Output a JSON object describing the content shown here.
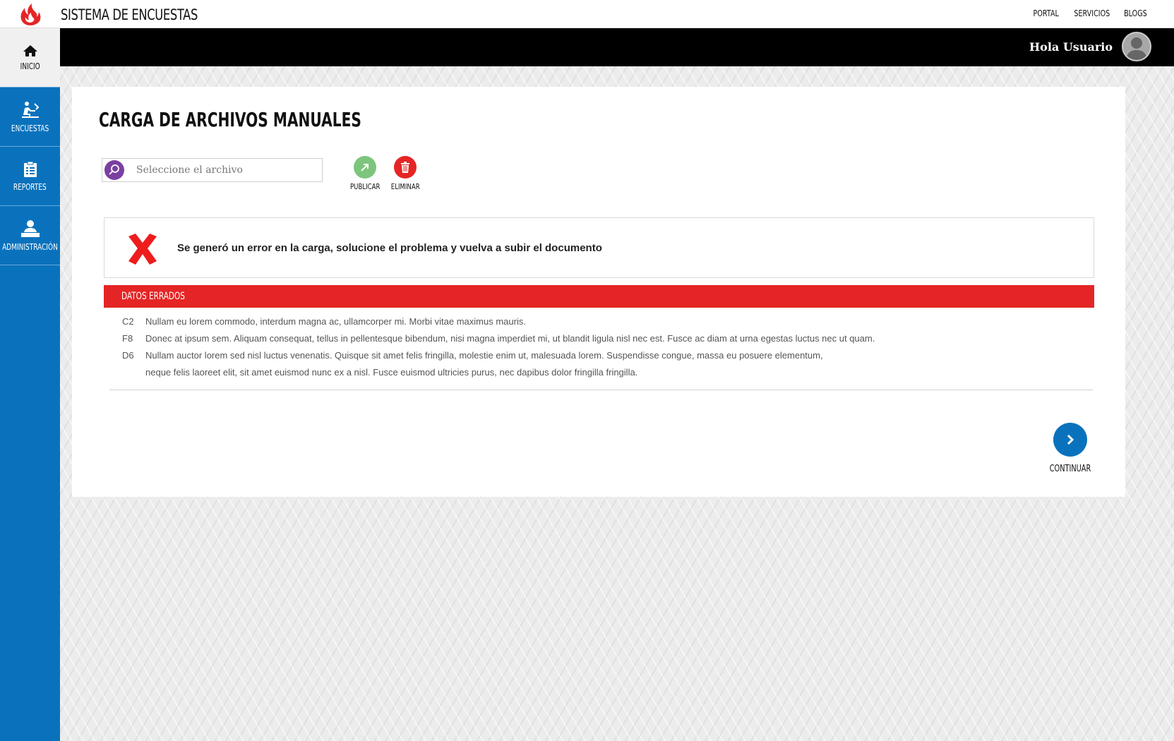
{
  "app": {
    "title": "SISTEMA DE ENCUESTAS",
    "logo_icon": "upc-flame-logo-icon",
    "brand_color": "#e52525"
  },
  "top_links": [
    {
      "label": "PORTAL"
    },
    {
      "label": "SERVICIOS"
    },
    {
      "label": "BLOGS"
    }
  ],
  "header": {
    "greeting": "Hola Usuario",
    "avatar_icon": "user-avatar-icon"
  },
  "sidebar": {
    "color": "#0a72bd",
    "items": [
      {
        "label": "INICIO",
        "icon": "home-icon",
        "active": true
      },
      {
        "label": "ENCUESTAS",
        "icon": "survey-icon",
        "active": false
      },
      {
        "label": "REPORTES",
        "icon": "clipboard-icon",
        "active": false
      },
      {
        "label": "ADMINISTRACIÓN",
        "icon": "admin-icon",
        "active": false
      }
    ]
  },
  "page": {
    "title": "CARGA DE ARCHIVOS  MANUALES"
  },
  "upload": {
    "placeholder": "Seleccione el archivo",
    "value": "",
    "publish_label": "PUBLICAR",
    "publish_color": "#7dc57d",
    "delete_label": "ELIMINAR",
    "delete_color": "#e52525"
  },
  "error": {
    "message": "Se generó un error en la carga, solucione el problema y vuelva a subir el documento",
    "icon": "red-x-icon"
  },
  "errors_table": {
    "header": "DATOS ERRADOS",
    "rows": [
      {
        "code": "C2",
        "text": "Nullam eu lorem commodo, interdum magna ac, ullamcorper mi. Morbi vitae maximus mauris."
      },
      {
        "code": "F8",
        "text": "Donec at ipsum sem. Aliquam consequat, tellus in pellentesque bibendum, nisi magna imperdiet mi, ut blandit ligula nisl nec est. Fusce ac diam at urna egestas luctus nec ut quam."
      },
      {
        "code": "D6",
        "text": "Nullam auctor lorem sed nisl luctus venenatis. Quisque sit amet felis fringilla, molestie enim ut, malesuada lorem. Suspendisse congue, massa eu posuere elementum, neque felis laoreet elit, sit amet euismod nunc ex a nisl. Fusce euismod ultricies purus, nec dapibus dolor fringilla fringilla."
      }
    ]
  },
  "continue": {
    "label": "CONTINUAR",
    "icon": "chevron-right-icon"
  }
}
